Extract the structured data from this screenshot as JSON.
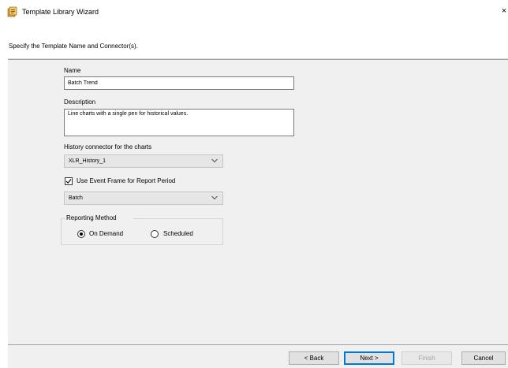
{
  "window": {
    "title": "Template Library Wizard",
    "close_glyph": "×"
  },
  "header": {
    "instruction": "Specify the Template Name and Connector(s)."
  },
  "form": {
    "name_label": "Name",
    "name_value": "Batch Trend",
    "description_label": "Description",
    "description_value": "Line charts with a single pen for historical values.",
    "history_label": "History connector for the charts",
    "history_selected": "XLR_History_1",
    "event_frame_label": "Use Event Frame for Report Period",
    "event_frame_checked": true,
    "event_frame_selected": "Batch",
    "reporting_method_label": "Reporting Method",
    "reporting_options": [
      {
        "label": "On Demand",
        "selected": true
      },
      {
        "label": "Scheduled",
        "selected": false
      }
    ]
  },
  "footer": {
    "back_label": "< Back",
    "next_label": "Next >",
    "finish_label": "Finish",
    "cancel_label": "Cancel"
  },
  "icons": {
    "app": "template-library-icon",
    "close": "close-icon",
    "dropdown": "chevron-down-icon",
    "check": "checkmark-icon"
  },
  "colors": {
    "accent": "#0078d7",
    "panel": "#f0f0f0",
    "dropdown_bg": "#e6e6e6",
    "disabled_text": "#a3a3a3"
  }
}
